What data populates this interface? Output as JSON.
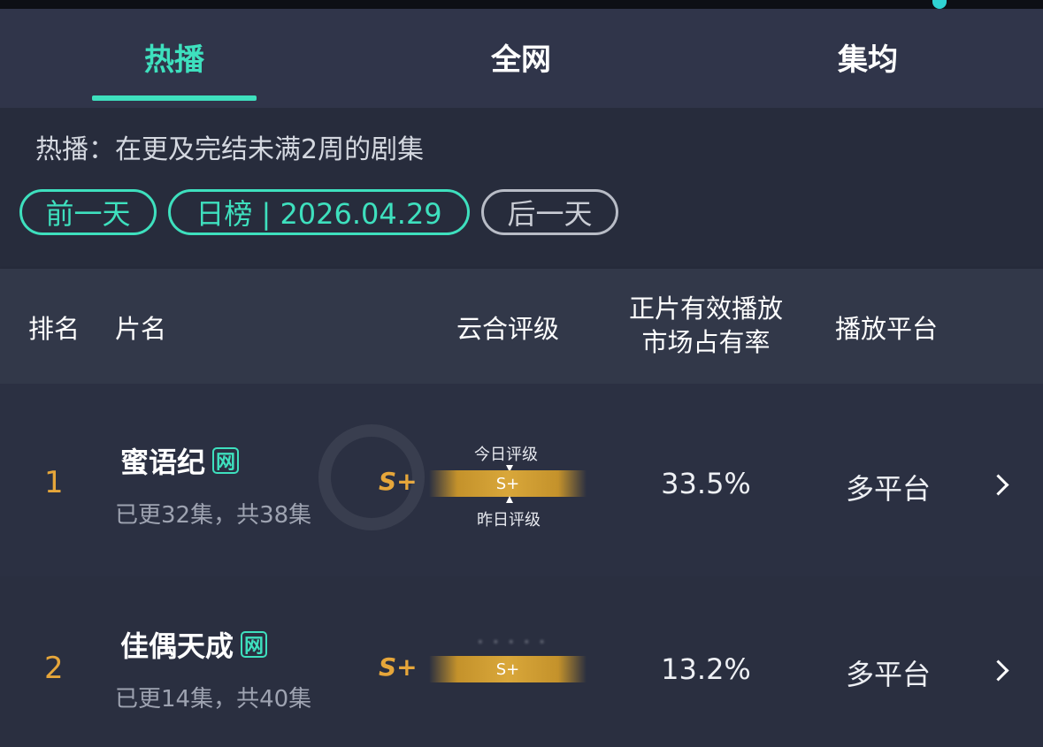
{
  "tabs": [
    {
      "label": "热播",
      "active": true
    },
    {
      "label": "全网",
      "active": false
    },
    {
      "label": "集均",
      "active": false
    }
  ],
  "info": {
    "description": "热播：在更及完结未满2周的剧集",
    "prev_day": "前一天",
    "date_pill": "日榜 | 2026.04.29",
    "next_day": "后一天"
  },
  "table_header": {
    "rank": "排名",
    "title": "片名",
    "rating": "云合评级",
    "share_line1": "正片有效播放",
    "share_line2": "市场占有率",
    "platform": "播放平台"
  },
  "rows": [
    {
      "rank": "1",
      "title": "蜜语纪",
      "badge": "网",
      "episodes": "已更32集，共38集",
      "grade": "S+",
      "bar_grade": "S+",
      "today_label": "今日评级",
      "yesterday_label": "昨日评级",
      "share": "33.5%",
      "platform": "多平台"
    },
    {
      "rank": "2",
      "title": "佳偶天成",
      "badge": "网",
      "episodes": "已更14集，共40集",
      "grade": "S+",
      "bar_grade": "S+",
      "share": "13.2%",
      "platform": "多平台"
    }
  ],
  "colors": {
    "accent": "#3ee0be",
    "gold": "#e6a63a",
    "background": "#262b3b"
  },
  "icons": [
    "chevron-right-icon",
    "net-badge-icon"
  ]
}
